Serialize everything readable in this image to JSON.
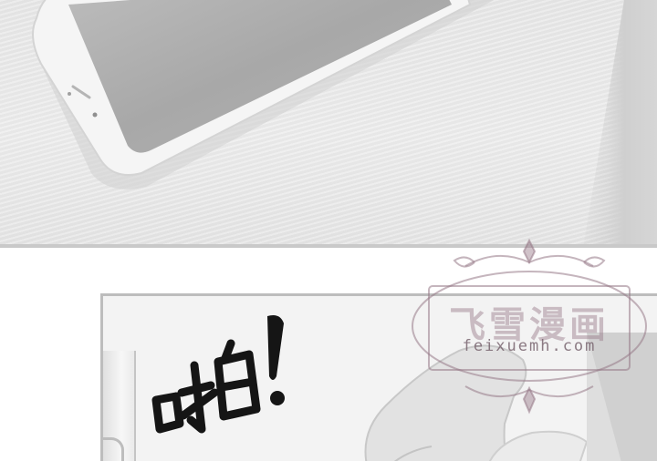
{
  "panels": {
    "top": {
      "description_icon": "smartphone-on-table-icon"
    },
    "bottom": {
      "sound_effect": "啪!",
      "icon_cup": "cup-icon",
      "icon_hand": "hand-icon"
    }
  },
  "watermark": {
    "title": "飞雪漫画",
    "url": "feixuemh.com",
    "icon": "ornamental-frame-icon"
  },
  "colors": {
    "background": "#ffffff",
    "panel_border": "#bdbdbd",
    "watermark_tint": "#968087"
  }
}
